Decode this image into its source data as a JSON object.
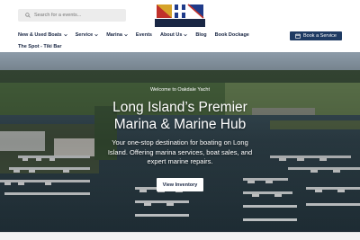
{
  "header": {
    "search": {
      "placeholder": "Search for a events...",
      "icon": "search-icon"
    },
    "logo": {
      "brand_text": "OAKDALE YACHT",
      "icon": "yacht-flag-logo"
    },
    "nav": {
      "items": [
        {
          "label": "New & Used Boats",
          "has_dropdown": true
        },
        {
          "label": "Service",
          "has_dropdown": true
        },
        {
          "label": "Marina",
          "has_dropdown": true
        },
        {
          "label": "Events",
          "has_dropdown": false
        },
        {
          "label": "About Us",
          "has_dropdown": true
        },
        {
          "label": "Blog",
          "has_dropdown": false
        },
        {
          "label": "Book Dockage",
          "has_dropdown": false
        }
      ],
      "second_row": {
        "label": "The Spot - Tiki Bar"
      }
    },
    "book_service": {
      "label": "Book a Service",
      "icon": "calendar-icon"
    }
  },
  "hero": {
    "welcome": "Welcome to Oakdale Yacht",
    "headline_line1": "Long Island’s Premier",
    "headline_line2": "Marina & Marine Hub",
    "subhead_line1": "Your one-stop destination for boating on Long",
    "subhead_line2": "Island. Offering marina services, boat sales, and",
    "subhead_line3": "expert marine repairs.",
    "cta_label": "View Inventory"
  },
  "colors": {
    "navy": "#1a2744",
    "button_blue": "#1f3b63",
    "search_bg": "#ececec",
    "white": "#ffffff"
  }
}
